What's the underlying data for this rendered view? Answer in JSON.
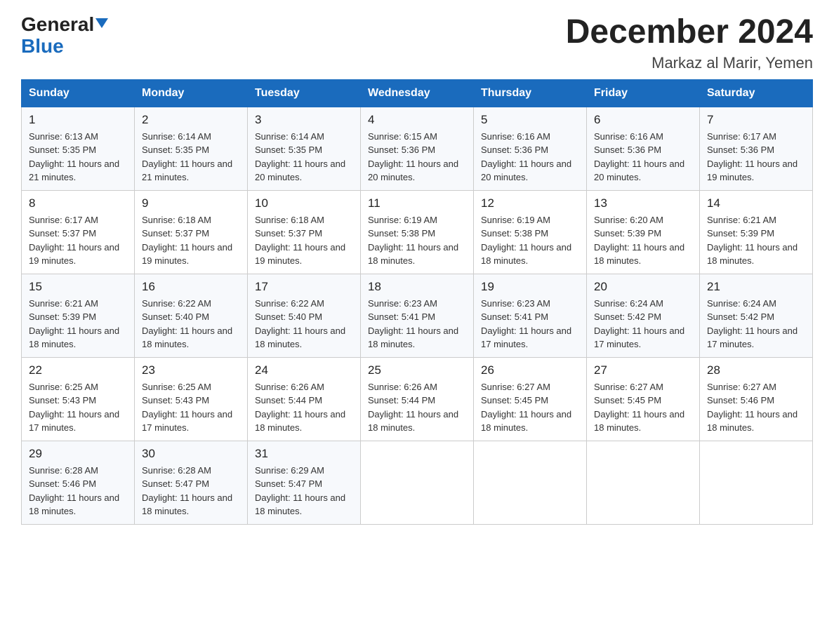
{
  "header": {
    "logo_general": "General",
    "logo_blue": "Blue",
    "title": "December 2024",
    "location": "Markaz al Marir, Yemen"
  },
  "weekdays": [
    "Sunday",
    "Monday",
    "Tuesday",
    "Wednesday",
    "Thursday",
    "Friday",
    "Saturday"
  ],
  "weeks": [
    [
      {
        "day": "1",
        "sunrise": "6:13 AM",
        "sunset": "5:35 PM",
        "daylight": "11 hours and 21 minutes."
      },
      {
        "day": "2",
        "sunrise": "6:14 AM",
        "sunset": "5:35 PM",
        "daylight": "11 hours and 21 minutes."
      },
      {
        "day": "3",
        "sunrise": "6:14 AM",
        "sunset": "5:35 PM",
        "daylight": "11 hours and 20 minutes."
      },
      {
        "day": "4",
        "sunrise": "6:15 AM",
        "sunset": "5:36 PM",
        "daylight": "11 hours and 20 minutes."
      },
      {
        "day": "5",
        "sunrise": "6:16 AM",
        "sunset": "5:36 PM",
        "daylight": "11 hours and 20 minutes."
      },
      {
        "day": "6",
        "sunrise": "6:16 AM",
        "sunset": "5:36 PM",
        "daylight": "11 hours and 20 minutes."
      },
      {
        "day": "7",
        "sunrise": "6:17 AM",
        "sunset": "5:36 PM",
        "daylight": "11 hours and 19 minutes."
      }
    ],
    [
      {
        "day": "8",
        "sunrise": "6:17 AM",
        "sunset": "5:37 PM",
        "daylight": "11 hours and 19 minutes."
      },
      {
        "day": "9",
        "sunrise": "6:18 AM",
        "sunset": "5:37 PM",
        "daylight": "11 hours and 19 minutes."
      },
      {
        "day": "10",
        "sunrise": "6:18 AM",
        "sunset": "5:37 PM",
        "daylight": "11 hours and 19 minutes."
      },
      {
        "day": "11",
        "sunrise": "6:19 AM",
        "sunset": "5:38 PM",
        "daylight": "11 hours and 18 minutes."
      },
      {
        "day": "12",
        "sunrise": "6:19 AM",
        "sunset": "5:38 PM",
        "daylight": "11 hours and 18 minutes."
      },
      {
        "day": "13",
        "sunrise": "6:20 AM",
        "sunset": "5:39 PM",
        "daylight": "11 hours and 18 minutes."
      },
      {
        "day": "14",
        "sunrise": "6:21 AM",
        "sunset": "5:39 PM",
        "daylight": "11 hours and 18 minutes."
      }
    ],
    [
      {
        "day": "15",
        "sunrise": "6:21 AM",
        "sunset": "5:39 PM",
        "daylight": "11 hours and 18 minutes."
      },
      {
        "day": "16",
        "sunrise": "6:22 AM",
        "sunset": "5:40 PM",
        "daylight": "11 hours and 18 minutes."
      },
      {
        "day": "17",
        "sunrise": "6:22 AM",
        "sunset": "5:40 PM",
        "daylight": "11 hours and 18 minutes."
      },
      {
        "day": "18",
        "sunrise": "6:23 AM",
        "sunset": "5:41 PM",
        "daylight": "11 hours and 18 minutes."
      },
      {
        "day": "19",
        "sunrise": "6:23 AM",
        "sunset": "5:41 PM",
        "daylight": "11 hours and 17 minutes."
      },
      {
        "day": "20",
        "sunrise": "6:24 AM",
        "sunset": "5:42 PM",
        "daylight": "11 hours and 17 minutes."
      },
      {
        "day": "21",
        "sunrise": "6:24 AM",
        "sunset": "5:42 PM",
        "daylight": "11 hours and 17 minutes."
      }
    ],
    [
      {
        "day": "22",
        "sunrise": "6:25 AM",
        "sunset": "5:43 PM",
        "daylight": "11 hours and 17 minutes."
      },
      {
        "day": "23",
        "sunrise": "6:25 AM",
        "sunset": "5:43 PM",
        "daylight": "11 hours and 17 minutes."
      },
      {
        "day": "24",
        "sunrise": "6:26 AM",
        "sunset": "5:44 PM",
        "daylight": "11 hours and 18 minutes."
      },
      {
        "day": "25",
        "sunrise": "6:26 AM",
        "sunset": "5:44 PM",
        "daylight": "11 hours and 18 minutes."
      },
      {
        "day": "26",
        "sunrise": "6:27 AM",
        "sunset": "5:45 PM",
        "daylight": "11 hours and 18 minutes."
      },
      {
        "day": "27",
        "sunrise": "6:27 AM",
        "sunset": "5:45 PM",
        "daylight": "11 hours and 18 minutes."
      },
      {
        "day": "28",
        "sunrise": "6:27 AM",
        "sunset": "5:46 PM",
        "daylight": "11 hours and 18 minutes."
      }
    ],
    [
      {
        "day": "29",
        "sunrise": "6:28 AM",
        "sunset": "5:46 PM",
        "daylight": "11 hours and 18 minutes."
      },
      {
        "day": "30",
        "sunrise": "6:28 AM",
        "sunset": "5:47 PM",
        "daylight": "11 hours and 18 minutes."
      },
      {
        "day": "31",
        "sunrise": "6:29 AM",
        "sunset": "5:47 PM",
        "daylight": "11 hours and 18 minutes."
      },
      null,
      null,
      null,
      null
    ]
  ]
}
